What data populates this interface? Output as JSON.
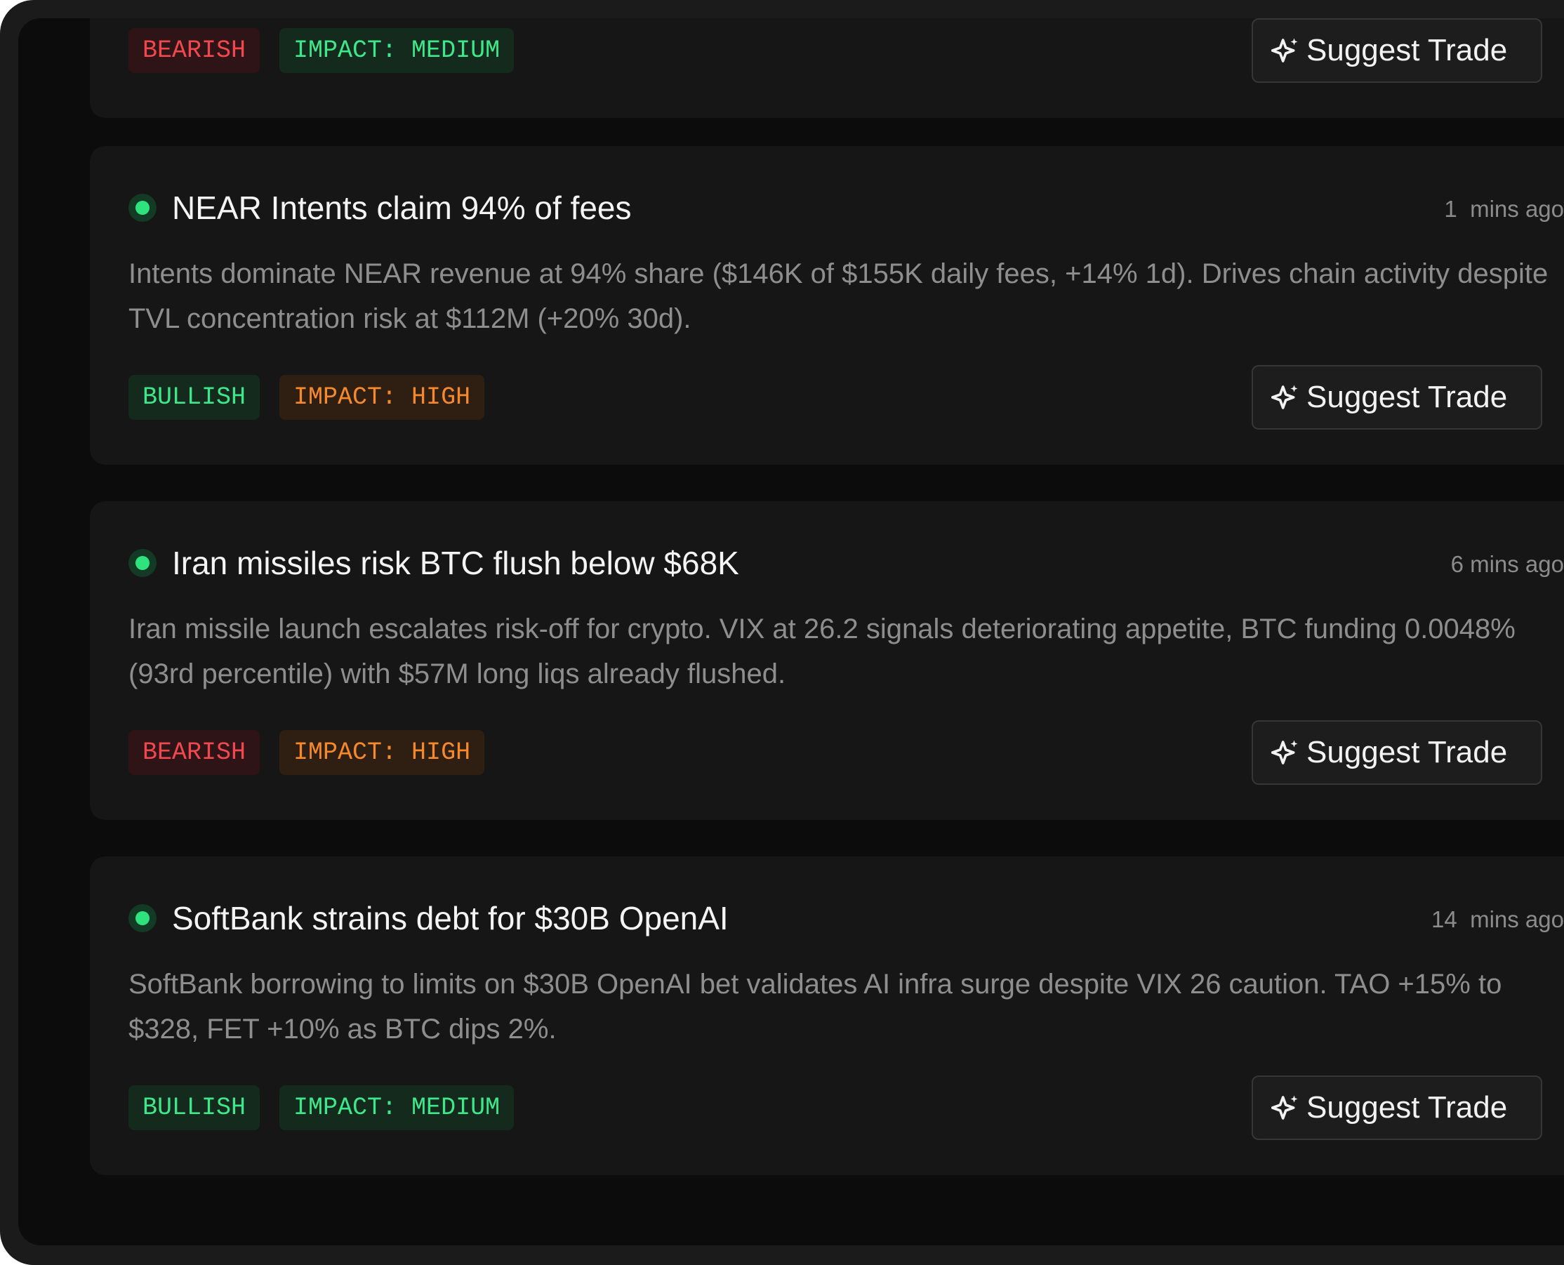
{
  "colors": {
    "background": "#0c0c0c",
    "card": "#161616",
    "bullish": "#3ee88a",
    "bearish": "#f0484e",
    "impact_high": "#f5892b",
    "live_dot": "#2ee37e"
  },
  "news": [
    {
      "title": "",
      "time": "",
      "summary": "",
      "sentiment": "BEARISH",
      "impact": "IMPACT: MEDIUM",
      "action": "Suggest Trade"
    },
    {
      "title": "NEAR Intents claim 94% of fees",
      "time": "1  mins ago",
      "summary": "Intents dominate NEAR revenue at 94% share ($146K of $155K daily fees, +14% 1d). Drives chain activity despite TVL concentration risk at $112M (+20% 30d).",
      "sentiment": "BULLISH",
      "impact": "IMPACT: HIGH",
      "action": "Suggest Trade"
    },
    {
      "title": "Iran missiles risk BTC flush below $68K",
      "time": "6 mins ago",
      "summary": "Iran missile launch escalates risk-off for crypto. VIX at 26.2 signals deteriorating appetite, BTC funding 0.0048% (93rd percentile) with $57M long liqs already flushed.",
      "sentiment": "BEARISH",
      "impact": "IMPACT: HIGH",
      "action": "Suggest Trade"
    },
    {
      "title": "SoftBank strains debt for $30B OpenAI",
      "time": "14  mins ago",
      "summary": "SoftBank borrowing to limits on $30B OpenAI bet validates AI infra surge despite VIX 26 caution. TAO +15% to $328, FET +10% as BTC dips 2%.",
      "sentiment": "BULLISH",
      "impact": "IMPACT: MEDIUM",
      "action": "Suggest Trade"
    }
  ]
}
